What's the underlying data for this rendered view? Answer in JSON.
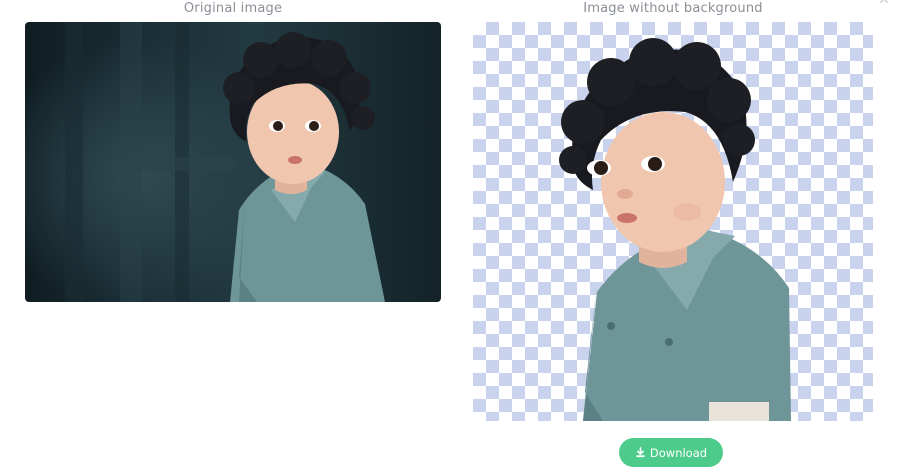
{
  "captions": {
    "original": "Original image",
    "result": "Image without background"
  },
  "actions": {
    "download_label": "Download",
    "download_icon": "download-icon",
    "close_icon": "close-icon"
  },
  "colors": {
    "download_button": "#4ccb8a",
    "transparency_checker": "#c9d3ee",
    "caption_text": "#8a8f97"
  }
}
